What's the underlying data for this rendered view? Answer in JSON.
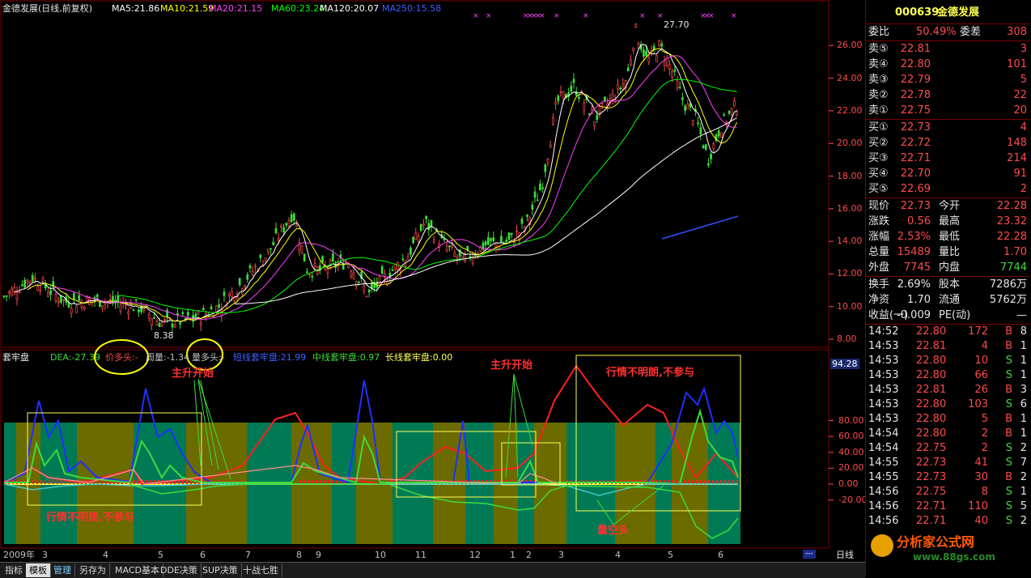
{
  "stock": {
    "code": "000639",
    "name": "金德发展"
  },
  "kline_header": {
    "title": "金德发展(日线,前复权)",
    "ma": [
      {
        "label": "MA5:21.86",
        "color": "#ffffff"
      },
      {
        "label": "MA10:21.59",
        "color": "#ffff00"
      },
      {
        "label": "MA20:21.15",
        "color": "#ff40ff"
      },
      {
        "label": "MA60:23.24",
        "color": "#00ff00"
      },
      {
        "label": "MA120:20.07",
        "color": "#ffffff"
      },
      {
        "label": "MA250:15.58",
        "color": "#4060ff"
      }
    ]
  },
  "price_axis": [
    "26.00",
    "24.00",
    "22.00",
    "20.00",
    "18.00",
    "16.00",
    "14.00",
    "12.00",
    "10.00",
    "8.00"
  ],
  "price_annotations": {
    "high": "27.70",
    "low": "8.38"
  },
  "indicator": {
    "name": "套牢盘",
    "dea": "DEA:-27.39",
    "price_bull": "价多头:-",
    "vol_label": "周量:-1.34",
    "vol_bull": "量多头:-",
    "short": "短线套牢盘:21.99",
    "mid": "中线套牢盘:0.97",
    "long": "长线套牢盘:0.00",
    "axis": [
      "80.00",
      "60.00",
      "40.00",
      "20.00",
      "0.00",
      "-20.00"
    ],
    "axis_tag": "94.28"
  },
  "annotations": {
    "main_rise_1": "主升开始",
    "main_rise_2": "主升开始",
    "unclear_1": "行情不明朗,不参与",
    "unclear_2": "行情不明朗,不参与",
    "volume_empty": "量空头"
  },
  "time_axis": {
    "year": "2009年",
    "months": [
      "3",
      "4",
      "5",
      "6",
      "7",
      "8",
      "9",
      "10",
      "11",
      "12",
      "1",
      "2",
      "3",
      "4",
      "5",
      "6"
    ],
    "period": "日线"
  },
  "tabs": [
    "指标",
    "模板",
    "管理",
    "另存为",
    "MACD基本",
    "DDE决策",
    "SUP决策",
    "十战七胜"
  ],
  "quote": {
    "weibi_label": "委比",
    "weibi": "50.49%",
    "weicha_label": "委差",
    "weicha": "308",
    "asks": [
      {
        "label": "卖⑤",
        "price": "22.81",
        "vol": "3"
      },
      {
        "label": "卖④",
        "price": "22.80",
        "vol": "101"
      },
      {
        "label": "卖③",
        "price": "22.79",
        "vol": "5"
      },
      {
        "label": "卖②",
        "price": "22.78",
        "vol": "22"
      },
      {
        "label": "卖①",
        "price": "22.75",
        "vol": "20"
      }
    ],
    "bids": [
      {
        "label": "买①",
        "price": "22.73",
        "vol": "4"
      },
      {
        "label": "买②",
        "price": "22.72",
        "vol": "148"
      },
      {
        "label": "买③",
        "price": "22.71",
        "vol": "214"
      },
      {
        "label": "买④",
        "price": "22.70",
        "vol": "91"
      },
      {
        "label": "买⑤",
        "price": "22.69",
        "vol": "2"
      }
    ],
    "stats": [
      {
        "l1": "现价",
        "v1": "22.73",
        "l2": "今开",
        "v2": "22.28"
      },
      {
        "l1": "涨跌",
        "v1": "0.56",
        "l2": "最高",
        "v2": "23.32"
      },
      {
        "l1": "涨幅",
        "v1": "2.53%",
        "l2": "最低",
        "v2": "22.28"
      },
      {
        "l1": "总量",
        "v1": "15489",
        "l2": "量比",
        "v2": "1.70"
      },
      {
        "l1": "外盘",
        "v1": "7745",
        "l2": "内盘",
        "v2": "7744"
      }
    ],
    "fin": [
      {
        "l1": "换手",
        "v1": "2.69%",
        "l2": "股本",
        "v2": "7286万"
      },
      {
        "l1": "净资",
        "v1": "1.70",
        "l2": "流通",
        "v2": "5762万"
      },
      {
        "l1": "收益(一)",
        "v1": "-0.009",
        "l2": "PE(动)",
        "v2": "—"
      }
    ],
    "ticks": [
      {
        "t": "14:52",
        "p": "22.80",
        "v": "172",
        "d": "B",
        "n": "8"
      },
      {
        "t": "14:53",
        "p": "22.81",
        "v": "4",
        "d": "B",
        "n": "1"
      },
      {
        "t": "14:53",
        "p": "22.80",
        "v": "10",
        "d": "S",
        "n": "1"
      },
      {
        "t": "14:53",
        "p": "22.80",
        "v": "66",
        "d": "S",
        "n": "1"
      },
      {
        "t": "14:53",
        "p": "22.81",
        "v": "26",
        "d": "B",
        "n": "3"
      },
      {
        "t": "14:53",
        "p": "22.80",
        "v": "103",
        "d": "S",
        "n": "6"
      },
      {
        "t": "14:53",
        "p": "22.80",
        "v": "5",
        "d": "B",
        "n": "1"
      },
      {
        "t": "14:54",
        "p": "22.80",
        "v": "2",
        "d": "B",
        "n": "1"
      },
      {
        "t": "14:54",
        "p": "22.75",
        "v": "2",
        "d": "S",
        "n": "2"
      },
      {
        "t": "14:55",
        "p": "22.73",
        "v": "41",
        "d": "S",
        "n": "7"
      },
      {
        "t": "14:55",
        "p": "22.73",
        "v": "30",
        "d": "B",
        "n": "2"
      },
      {
        "t": "14:56",
        "p": "22.75",
        "v": "8",
        "d": "S",
        "n": "1"
      },
      {
        "t": "14:56",
        "p": "22.71",
        "v": "110",
        "d": "S",
        "n": "5"
      },
      {
        "t": "14:56",
        "p": "22.71",
        "v": "40",
        "d": "S",
        "n": "2"
      }
    ]
  },
  "watermark": {
    "line1": "分析家公式网",
    "line2": "www.88gs.com"
  },
  "colors": {
    "bg": "#000000",
    "up": "#ff4b4b",
    "down": "#3cdc3c",
    "grid": "#7a0000",
    "olive": "#6b6b00",
    "teal": "#007a55"
  }
}
